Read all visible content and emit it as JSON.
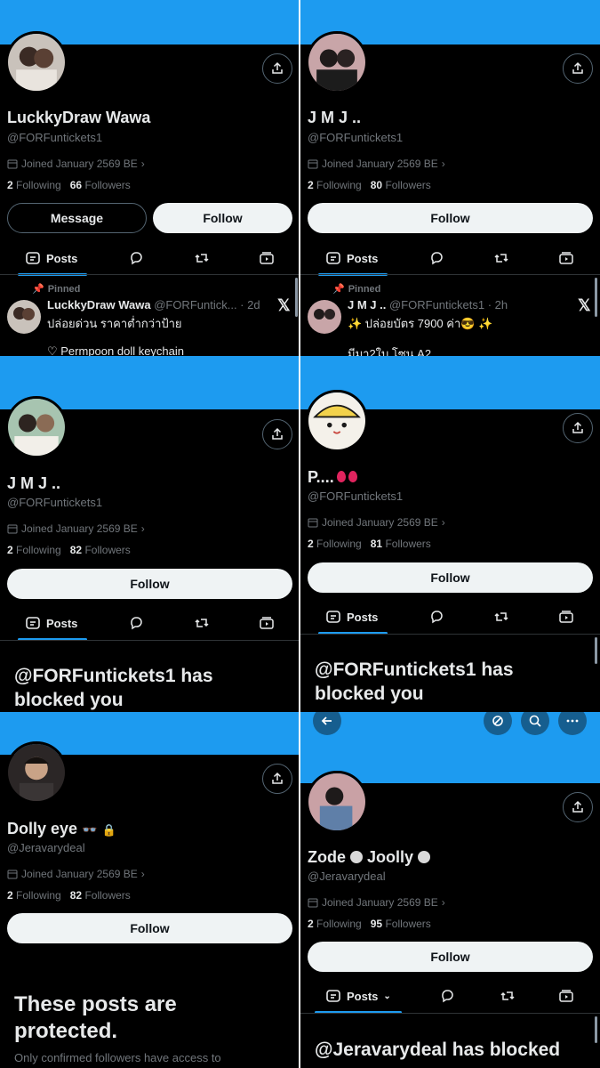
{
  "colors": {
    "accent": "#1d9bf0",
    "bg": "#000000",
    "text": "#e7e9ea",
    "muted": "#71767b"
  },
  "common": {
    "follow_label": "Follow",
    "message_label": "Message",
    "posts_tab": "Posts",
    "following_word": "Following",
    "followers_word": "Followers",
    "pinned_label": "Pinned"
  },
  "p1": {
    "name": "LuckkyDraw Wawa",
    "handle": "@FORFuntickets1",
    "joined": "Joined January 2569 BE",
    "following": "2",
    "followers": "66",
    "post_name": "LuckkyDraw Wawa",
    "post_meta": "@FORFuntick... · 2d",
    "post_text": "ปล่อยด่วน ราคาต่ำกว่าป้าย",
    "post_text2": "♡ Permpoon doll keychain"
  },
  "p2": {
    "name": "J M J ..",
    "handle": "@FORFuntickets1",
    "joined": "Joined January 2569 BE",
    "following": "2",
    "followers": "80",
    "post_name": "J M J ..",
    "post_meta": "@FORFuntickets1 · 2h",
    "post_text": "✨ ปล่อยบัตร 7900 ค่า😎 ✨",
    "post_text2": "มีมา2ใบ โซน A2"
  },
  "p3": {
    "name": "J M J ..",
    "handle": "@FORFuntickets1",
    "joined": "Joined January 2569 BE",
    "following": "2",
    "followers": "82",
    "blocked_line1": "@FORFuntickets1 has",
    "blocked_line2": "blocked you"
  },
  "p4": {
    "name": "P....",
    "handle": "@FORFuntickets1",
    "joined": "Joined January 2569 BE",
    "following": "2",
    "followers": "81",
    "blocked_line1": "@FORFuntickets1 has",
    "blocked_line2": "blocked you"
  },
  "p5": {
    "name": "Dolly eye",
    "name_emoji": "👓",
    "lock_icon": "🔒",
    "handle": "@Jeravarydeal",
    "joined": "Joined January 2569 BE",
    "following": "2",
    "followers": "82",
    "protected_line1": "These posts are",
    "protected_line2": "protected.",
    "protected_sub": "Only confirmed followers have access to"
  },
  "p6": {
    "name_part1": "Zode",
    "name_part2": "Joolly",
    "handle": "@Jeravarydeal",
    "joined": "Joined January 2569 BE",
    "following": "2",
    "followers": "95",
    "blocked_line1": "@Jeravarydeal has blocked"
  }
}
